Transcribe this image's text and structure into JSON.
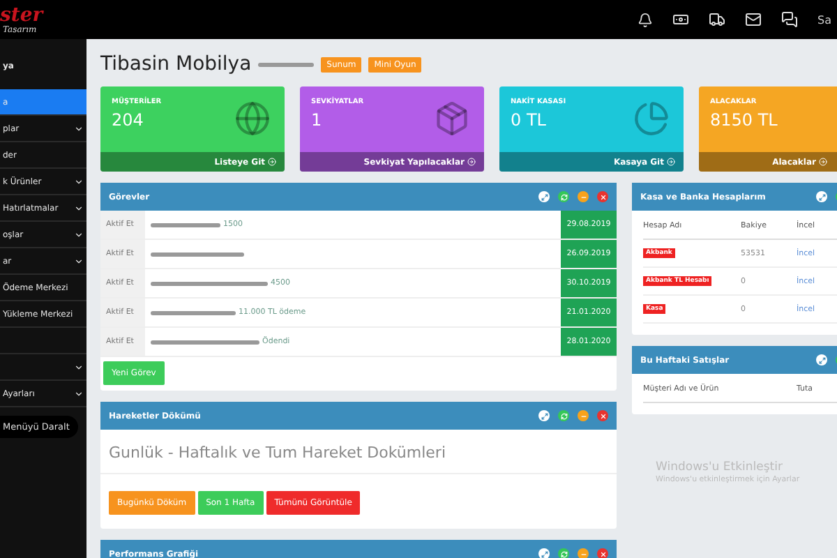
{
  "topbar": {
    "logo": "ster",
    "logo_sub": "Tasarım",
    "user": "Sa"
  },
  "sidebar": {
    "items": [
      {
        "label": "ya",
        "kind": "user",
        "selected": false,
        "expandable": false
      },
      {
        "label": "a",
        "kind": "item",
        "selected": true,
        "expandable": false
      },
      {
        "label": "plar",
        "kind": "item",
        "selected": false,
        "expandable": true
      },
      {
        "label": "der",
        "kind": "item",
        "selected": false,
        "expandable": false
      },
      {
        "label": "k Ürünler",
        "kind": "item",
        "selected": false,
        "expandable": true
      },
      {
        "label": "Hatırlatmalar",
        "kind": "item",
        "selected": false,
        "expandable": true
      },
      {
        "label": "oşlar",
        "kind": "item",
        "selected": false,
        "expandable": true
      },
      {
        "label": "ar",
        "kind": "item",
        "selected": false,
        "expandable": true
      },
      {
        "label": "Ödeme Merkezi",
        "kind": "item",
        "selected": false,
        "expandable": false
      },
      {
        "label": "Yükleme Merkezi",
        "kind": "item",
        "selected": false,
        "expandable": false
      },
      {
        "kind": "blank",
        "selected": false,
        "expandable": false
      },
      {
        "kind": "blank",
        "selected": false,
        "expandable": true
      },
      {
        "label": "Ayarları",
        "kind": "item",
        "selected": false,
        "expandable": true
      }
    ],
    "collapse": "Menüyü Daralt"
  },
  "header": {
    "title": "Tibasin Mobilya",
    "badges": [
      "Sunum",
      "Mini Oyun"
    ]
  },
  "cards": [
    {
      "title": "MÜŞTERİLER",
      "value": "204",
      "footer": "Listeye Git",
      "kind": "globe",
      "color": "#3dd15f"
    },
    {
      "title": "SEVKİYATLAR",
      "value": "1",
      "footer": "Sevkiyat Yapılacaklar",
      "kind": "box",
      "color": "#b25de8"
    },
    {
      "title": "NAKİT KASASI",
      "value": "0 TL",
      "footer": "Kasaya Git",
      "kind": "pie",
      "color": "#1cc7d9"
    },
    {
      "title": "ALACAKLAR",
      "value": "8150 TL",
      "footer": "Alacaklar",
      "kind": "none",
      "color": "#f5a623"
    }
  ],
  "tasks": {
    "title": "Görevler",
    "rows": [
      {
        "action": "Aktif Et",
        "text": "1500",
        "date": "29.08.2019"
      },
      {
        "action": "Aktif Et",
        "date": "26.09.2019"
      },
      {
        "action": "Aktif Et",
        "text": "4500",
        "date": "30.10.2019"
      },
      {
        "action": "Aktif Et",
        "text": "11.000 TL ödeme",
        "date": "21.01.2020"
      },
      {
        "action": "Aktif Et",
        "text": "Ödendi",
        "date": "28.01.2020"
      }
    ],
    "button": "Yeni Görev"
  },
  "movements": {
    "title": "Hareketler Dökümü",
    "heading": "Gunlük - Haftalık ve Tum Hareket Dokümleri",
    "buttons": [
      {
        "label": "Bugünkü Döküm",
        "color": "#f7931e"
      },
      {
        "label": "Son 1 Hafta",
        "color": "#3dcc5a"
      },
      {
        "label": "Tümünü Görüntüle",
        "color": "#ef2b2b"
      }
    ]
  },
  "performance": {
    "title": "Performans Grafiği"
  },
  "accounts": {
    "title": "Kasa ve Banka Hesaplarım",
    "columns": [
      "Hesap Adı",
      "Bakiye",
      "İncel"
    ],
    "rows": [
      {
        "name": "Akbank",
        "balance": "53531",
        "link": "İncel"
      },
      {
        "name": "Akbank TL Hesabı",
        "balance": "0",
        "link": "İncel"
      },
      {
        "name": "Kasa",
        "balance": "0",
        "link": "İncel"
      }
    ]
  },
  "sales": {
    "title": "Bu Haftaki Satışlar",
    "columns": [
      "Müşteri Adı ve Ürün",
      "Tuta"
    ]
  },
  "os_notice": {
    "title": "Windows'u Etkinleştir",
    "text": "Windows'u etkinleştirmek için Ayarlar"
  }
}
